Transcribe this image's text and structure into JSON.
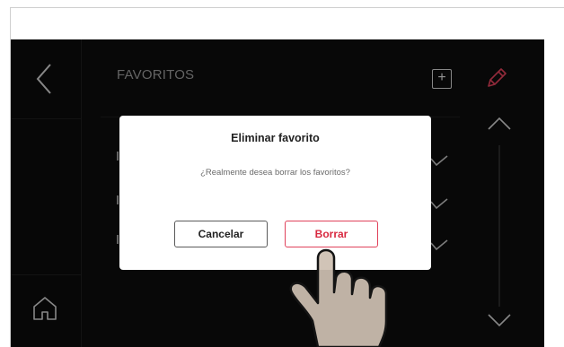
{
  "screen": {
    "title": "FAVORITOS",
    "add_symbol": "+",
    "icons": {
      "back": "chevron-left-icon",
      "home": "home-icon",
      "edit": "pencil-icon",
      "scroll_up": "chevron-up-icon",
      "scroll_down": "chevron-down-icon",
      "check": "check-icon"
    },
    "colors": {
      "background": "#0d0d0d",
      "accent": "#e0415a",
      "text_muted": "#9a9a9a"
    }
  },
  "dialog": {
    "title": "Eliminar favorito",
    "message": "¿Realmente desea borrar los favoritos?",
    "cancel_label": "Cancelar",
    "delete_label": "Borrar"
  },
  "overlay": {
    "illustration": "pointing-hand"
  }
}
